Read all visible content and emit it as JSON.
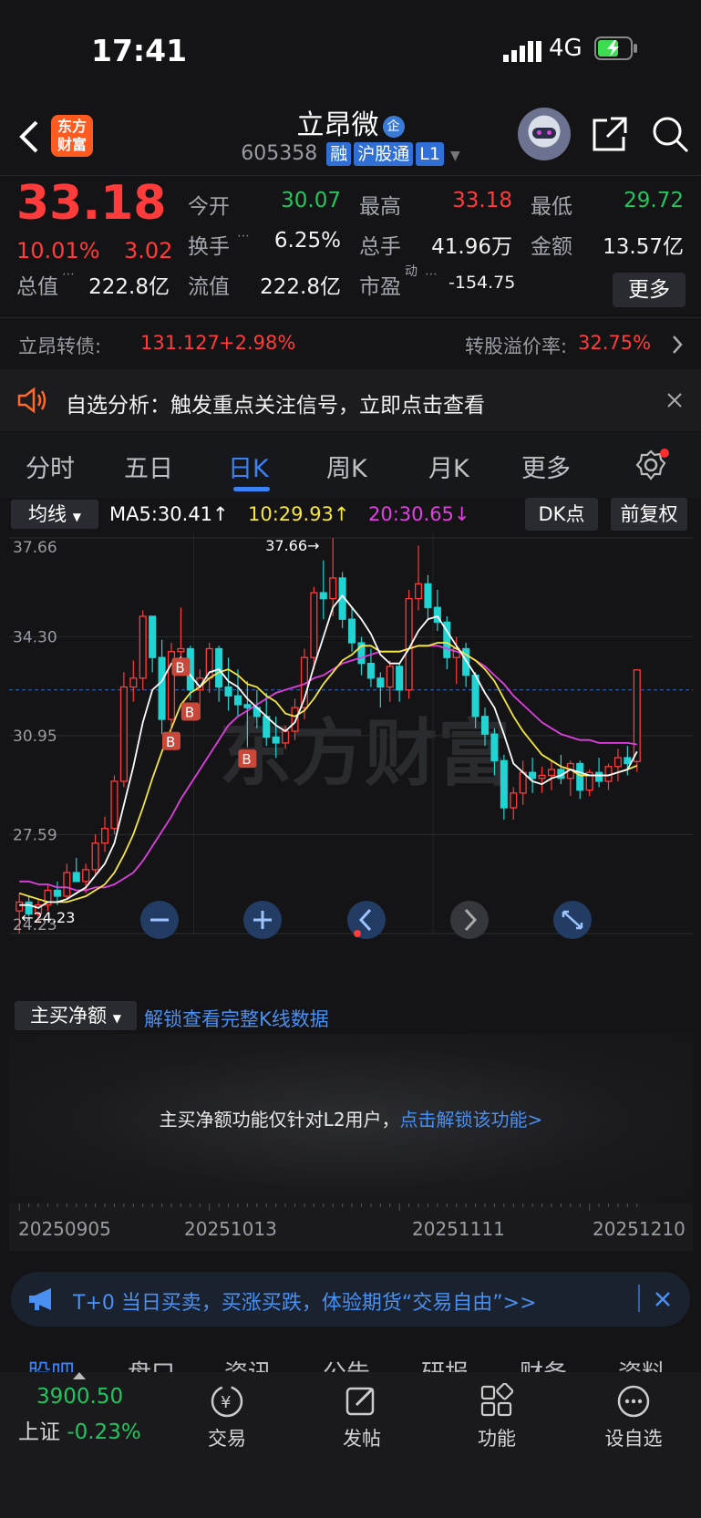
{
  "status": {
    "time": "17:41",
    "network": "4G"
  },
  "header": {
    "logo_line1": "东方",
    "logo_line2": "财富",
    "stock_name": "立昂微",
    "name_badge": "企",
    "code": "605358",
    "tags": [
      "融",
      "沪股通",
      "L1"
    ]
  },
  "quote": {
    "price": "33.18",
    "pct": "10.01%",
    "change": "3.02",
    "open_label": "今开",
    "open": "30.07",
    "high_label": "最高",
    "high": "33.18",
    "low_label": "最低",
    "low": "29.72",
    "turnover_label": "换手",
    "turnover": "6.25%",
    "volume_label": "总手",
    "volume": "41.96万",
    "amount_label": "金额",
    "amount": "13.57亿",
    "mktcap_label": "总值",
    "mktcap": "222.8亿",
    "float_label": "流值",
    "float": "222.8亿",
    "pe_label": "市盈",
    "pe_sup": "动",
    "pe": "-154.75",
    "more_label": "更多"
  },
  "bond": {
    "label": "立昂转债:",
    "price": "131.127",
    "pct": "+2.98%",
    "premium_label": "转股溢价率:",
    "premium": "32.75%"
  },
  "alert": {
    "text": "自选分析：触发重点关注信号，立即点击查看"
  },
  "tabs": [
    "分时",
    "五日",
    "日K",
    "周K",
    "月K",
    "更多"
  ],
  "active_tab": "日K",
  "ma": {
    "selector": "均线",
    "ma5": "MA5:30.41↑",
    "ma10": "10:29.93↑",
    "ma20": "20:30.65↓",
    "dk_label": "DK点",
    "adjust_label": "前复权",
    "ma5_color": "#ffffff",
    "ma10_color": "#f5e642",
    "ma20_color": "#e040e0"
  },
  "chart_data": {
    "type": "candlestick",
    "y_ticks": [
      "37.66",
      "34.30",
      "30.95",
      "27.59",
      "24.23"
    ],
    "ylim": [
      24.23,
      37.66
    ],
    "max_label": "37.66→",
    "min_label": "←24.23",
    "reference_line": 32.5,
    "up_color": "#ff3b3b",
    "down_color": "#21d4d4",
    "buy_marker": "B",
    "buy_marker_indices": [
      16,
      17,
      18,
      24
    ],
    "candles": [
      [
        25.0,
        25.6,
        24.23,
        25.3
      ],
      [
        25.3,
        25.5,
        24.8,
        24.9
      ],
      [
        24.9,
        25.4,
        24.6,
        25.2
      ],
      [
        25.2,
        25.9,
        25.0,
        25.7
      ],
      [
        25.7,
        26.0,
        25.2,
        25.5
      ],
      [
        25.5,
        26.6,
        25.4,
        26.3
      ],
      [
        26.3,
        26.8,
        26.0,
        26.0
      ],
      [
        26.0,
        26.6,
        25.6,
        26.4
      ],
      [
        26.4,
        27.6,
        26.2,
        27.3
      ],
      [
        27.3,
        28.2,
        27.0,
        27.8
      ],
      [
        27.8,
        29.6,
        27.6,
        29.4
      ],
      [
        29.4,
        33.1,
        29.2,
        32.6
      ],
      [
        32.6,
        33.5,
        32.1,
        32.9
      ],
      [
        32.9,
        35.2,
        32.5,
        35.0
      ],
      [
        35.0,
        35.0,
        33.1,
        33.6
      ],
      [
        33.6,
        34.2,
        31.0,
        31.5
      ],
      [
        31.5,
        34.1,
        31.2,
        33.8
      ],
      [
        33.8,
        35.3,
        33.1,
        33.9
      ],
      [
        33.9,
        34.0,
        32.2,
        32.5
      ],
      [
        32.5,
        33.2,
        31.5,
        32.9
      ],
      [
        32.9,
        34.1,
        32.4,
        33.9
      ],
      [
        33.9,
        34.0,
        32.1,
        32.6
      ],
      [
        32.6,
        33.6,
        31.8,
        32.3
      ],
      [
        32.3,
        33.2,
        31.6,
        32.0
      ],
      [
        32.0,
        32.8,
        30.6,
        31.9
      ],
      [
        31.9,
        32.5,
        31.2,
        31.6
      ],
      [
        31.6,
        32.4,
        30.6,
        30.9
      ],
      [
        30.9,
        31.6,
        30.2,
        30.7
      ],
      [
        30.7,
        31.3,
        30.5,
        31.1
      ],
      [
        31.1,
        32.2,
        30.8,
        31.9
      ],
      [
        31.9,
        33.9,
        31.5,
        33.6
      ],
      [
        33.6,
        36.0,
        33.2,
        35.8
      ],
      [
        35.8,
        36.9,
        34.9,
        35.6
      ],
      [
        35.6,
        37.66,
        35.0,
        36.3
      ],
      [
        36.3,
        36.5,
        34.6,
        34.9
      ],
      [
        34.9,
        35.3,
        33.8,
        34.1
      ],
      [
        34.1,
        34.3,
        33.0,
        33.4
      ],
      [
        33.4,
        33.9,
        32.6,
        32.9
      ],
      [
        32.9,
        33.1,
        31.9,
        32.6
      ],
      [
        32.6,
        33.5,
        32.1,
        33.3
      ],
      [
        33.3,
        33.4,
        32.1,
        32.5
      ],
      [
        32.5,
        35.9,
        32.2,
        35.6
      ],
      [
        35.6,
        37.4,
        35.2,
        36.1
      ],
      [
        36.1,
        36.4,
        34.9,
        35.3
      ],
      [
        35.3,
        35.9,
        34.5,
        34.8
      ],
      [
        34.8,
        35.0,
        33.2,
        33.6
      ],
      [
        33.6,
        34.3,
        32.7,
        33.9
      ],
      [
        33.9,
        34.1,
        32.6,
        33.0
      ],
      [
        33.0,
        33.1,
        31.2,
        31.6
      ],
      [
        31.6,
        31.9,
        30.6,
        31.0
      ],
      [
        31.0,
        31.2,
        29.6,
        30.1
      ],
      [
        30.1,
        30.3,
        28.1,
        28.5
      ],
      [
        28.5,
        29.2,
        28.1,
        29.0
      ],
      [
        29.0,
        30.1,
        28.6,
        29.7
      ],
      [
        29.7,
        30.2,
        29.0,
        29.5
      ],
      [
        29.5,
        29.9,
        29.0,
        29.6
      ],
      [
        29.6,
        30.1,
        29.1,
        29.8
      ],
      [
        29.8,
        30.3,
        29.3,
        29.5
      ],
      [
        29.5,
        30.1,
        28.9,
        30.0
      ],
      [
        30.0,
        30.1,
        28.8,
        29.1
      ],
      [
        29.1,
        29.8,
        28.9,
        29.7
      ],
      [
        29.7,
        30.2,
        29.2,
        29.4
      ],
      [
        29.4,
        30.0,
        29.1,
        29.9
      ],
      [
        29.9,
        30.5,
        29.4,
        30.2
      ],
      [
        30.2,
        30.6,
        29.6,
        30.0
      ],
      [
        30.07,
        33.18,
        29.72,
        33.18
      ]
    ],
    "ma5": [
      25.2,
      25.2,
      25.1,
      25.3,
      25.3,
      25.4,
      25.6,
      25.8,
      26.2,
      26.6,
      27.3,
      28.6,
      29.9,
      31.4,
      32.5,
      32.8,
      33.4,
      33.6,
      33.0,
      32.6,
      33.1,
      33.2,
      32.8,
      32.6,
      32.2,
      31.9,
      31.6,
      31.3,
      31.1,
      31.4,
      32.2,
      33.3,
      34.3,
      35.3,
      35.7,
      35.3,
      34.9,
      34.4,
      33.7,
      33.4,
      33.4,
      33.9,
      34.5,
      34.9,
      35.0,
      34.5,
      34.0,
      33.5,
      33.0,
      32.4,
      31.9,
      31.0,
      30.0,
      29.7,
      29.4,
      29.3,
      29.5,
      29.6,
      29.8,
      29.7,
      29.6,
      29.6,
      29.6,
      29.7,
      29.8,
      30.41
    ],
    "ma10": [
      25.6,
      25.5,
      25.4,
      25.3,
      25.3,
      25.3,
      25.4,
      25.5,
      25.7,
      25.9,
      26.3,
      26.9,
      27.6,
      28.5,
      29.5,
      30.4,
      31.2,
      32.0,
      32.4,
      32.6,
      32.9,
      33.1,
      33.2,
      33.0,
      32.7,
      32.6,
      32.3,
      32.1,
      31.7,
      31.6,
      31.8,
      32.2,
      32.7,
      33.1,
      33.5,
      33.7,
      34.0,
      34.0,
      33.8,
      33.8,
      33.8,
      33.9,
      34.0,
      34.0,
      34.1,
      34.1,
      33.9,
      33.7,
      33.5,
      33.2,
      32.8,
      32.2,
      31.6,
      31.1,
      30.7,
      30.3,
      30.1,
      29.9,
      29.8,
      29.6,
      29.6,
      29.6,
      29.6,
      29.7,
      29.8,
      29.93
    ],
    "ma20": [
      26.0,
      26.0,
      25.9,
      25.9,
      25.8,
      25.8,
      25.7,
      25.7,
      25.8,
      25.8,
      25.9,
      26.1,
      26.3,
      26.7,
      27.2,
      27.7,
      28.2,
      28.8,
      29.3,
      29.8,
      30.3,
      30.8,
      31.3,
      31.6,
      31.8,
      32.0,
      32.2,
      32.4,
      32.5,
      32.6,
      32.7,
      32.9,
      33.0,
      33.2,
      33.4,
      33.5,
      33.6,
      33.7,
      33.8,
      33.8,
      33.8,
      33.9,
      34.0,
      34.0,
      34.0,
      33.9,
      33.8,
      33.7,
      33.5,
      33.3,
      33.0,
      32.7,
      32.3,
      32.0,
      31.7,
      31.4,
      31.2,
      31.0,
      30.9,
      30.8,
      30.8,
      30.7,
      30.7,
      30.7,
      30.7,
      30.65
    ]
  },
  "chart_controls": [
    "zoom-out",
    "zoom-in",
    "prev",
    "next",
    "fullscreen"
  ],
  "indicator": {
    "selector": "主买净额",
    "unlock_link": "解锁查看完整K线数据",
    "l2_text": "主买净额功能仅针对L2用户，",
    "l2_link": "点击解锁该功能>"
  },
  "dates": [
    "20250905",
    "20251013",
    "20251111",
    "20251210"
  ],
  "banner": {
    "text": "T+0 当日买卖，买涨买跌，体验期货“交易自由”>>"
  },
  "bottom_tabs": [
    "股吧",
    "盘口",
    "资讯",
    "公告",
    "研报",
    "财务",
    "资料"
  ],
  "dock": {
    "index_value": "3900.50",
    "index_name": "上证",
    "index_pct": "-0.23%",
    "items": [
      "交易",
      "发帖",
      "功能",
      "设自选"
    ]
  }
}
